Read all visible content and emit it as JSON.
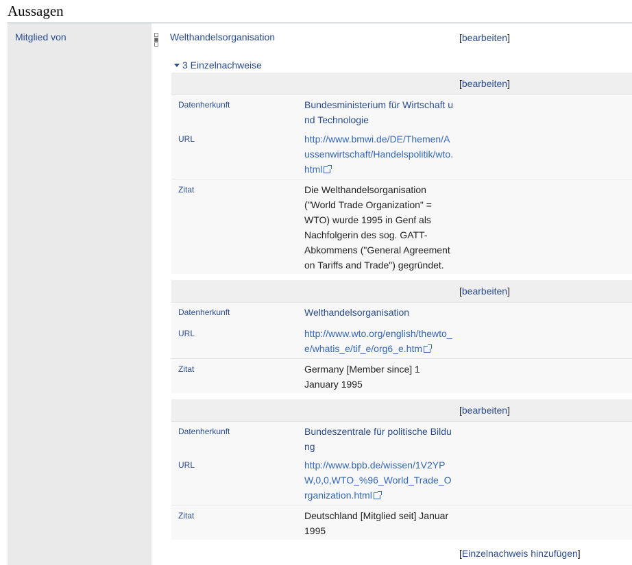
{
  "section_title": "Aussagen",
  "property": "Mitglied von",
  "value": "Welthandelsorganisation",
  "edit_label": "bearbeiten",
  "references_toggle": "3 Einzelnachweise",
  "add_reference_label": "Einzelnachweis hinzufügen",
  "references": [
    {
      "snaks": [
        {
          "property": "Datenherkunft",
          "value": "Bundesministerium für Wirtschaft und Technologie",
          "kind": "item"
        },
        {
          "property": "URL",
          "value": "http://www.bmwi.de/DE/Themen/Aussenwirtschaft/Handelspolitik/wto.html",
          "kind": "url"
        }
      ],
      "quote": {
        "property": "Zitat",
        "value": "Die Welthandelsorganisation (\"World Trade Organization\" = WTO) wurde 1995 in Genf als Nachfolgerin des sog. GATT-Abkommens (\"General Agreement on Tariffs and Trade\") gegründet."
      }
    },
    {
      "snaks": [
        {
          "property": "Datenherkunft",
          "value": "Welthandelsorganisation",
          "kind": "item"
        },
        {
          "property": "URL",
          "value": "http://www.wto.org/english/thewto_e/whatis_e/tif_e/org6_e.htm",
          "kind": "url"
        }
      ],
      "quote": {
        "property": "Zitat",
        "value": "Germany [Member since] 1 January 1995"
      }
    },
    {
      "snaks": [
        {
          "property": "Datenherkunft",
          "value": "Bundeszentrale für politische Bildung",
          "kind": "item"
        },
        {
          "property": "URL",
          "value": "http://www.bpb.de/wissen/1V2YPW,0,0,WTO_%96_World_Trade_Organization.html",
          "kind": "url"
        }
      ],
      "quote": {
        "property": "Zitat",
        "value": "Deutschland [Mitglied seit] Januar 1995"
      }
    }
  ]
}
